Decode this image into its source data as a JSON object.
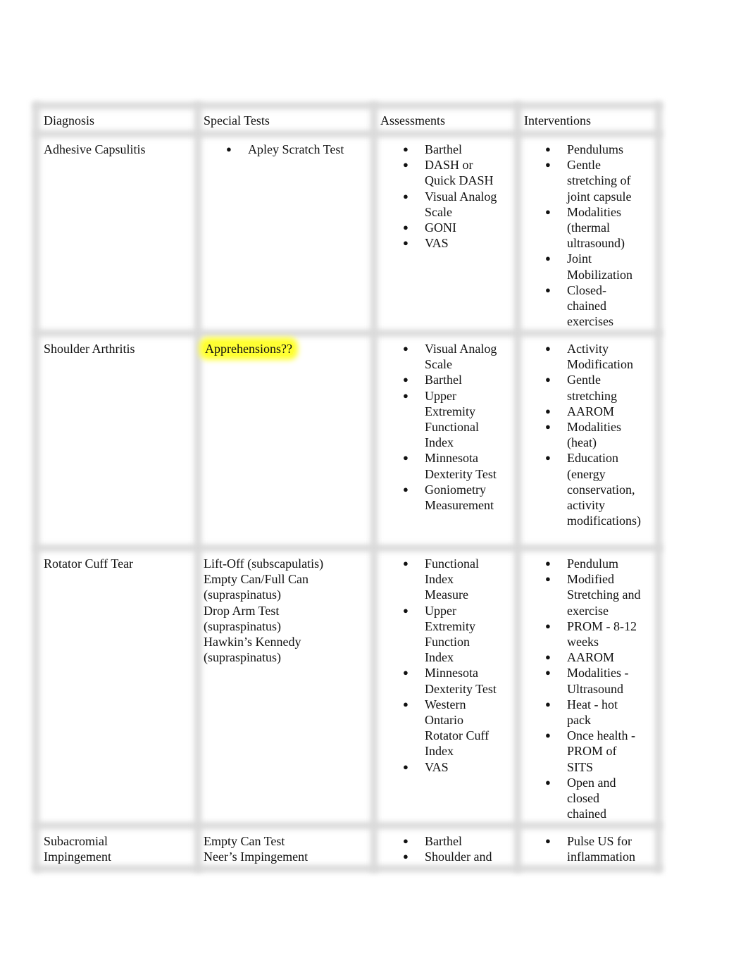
{
  "document": {
    "table": {
      "headers": [
        "Diagnosis",
        "Special Tests",
        "Assessments",
        "Interventions"
      ],
      "rows": [
        {
          "diagnosis": "Adhesive Capsulitis",
          "special_tests": {
            "type": "bullets",
            "items": [
              "Apley Scratch Test"
            ]
          },
          "assessments": [
            "Barthel",
            "DASH or Quick DASH",
            "Visual Analog Scale",
            "GONI",
            "VAS"
          ],
          "interventions": [
            "Pendulums",
            "Gentle stretching of joint capsule",
            "Modalities (thermal ultrasound)",
            "Joint Mobilization",
            "Closed-chained exercises"
          ]
        },
        {
          "diagnosis": "Shoulder Arthritis",
          "special_tests": {
            "type": "highlight",
            "text": "Apprehensions??",
            "highlight_color": "#ffff33"
          },
          "assessments": [
            "Visual Analog Scale",
            "Barthel",
            "Upper Extremity Functional Index",
            "Minnesota Dexterity Test",
            "Goniometry Measurement"
          ],
          "interventions": [
            "Activity Modification",
            "Gentle stretching",
            "AAROM",
            "Modalities (heat)",
            "Education (energy conservation, activity modifications)"
          ]
        },
        {
          "diagnosis": "Rotator Cuff Tear",
          "special_tests": {
            "type": "lines",
            "items": [
              "Lift-Off (subscapulatis)",
              "Empty Can/Full Can (supraspinatus)",
              "Drop Arm Test (supraspinatus)",
              "Hawkin’s Kennedy (supraspinatus)"
            ]
          },
          "assessments": [
            "Functional Index Measure",
            "Upper Extremity Function Index",
            "Minnesota Dexterity Test",
            "Western Ontario Rotator Cuff Index",
            "VAS"
          ],
          "interventions": [
            "Pendulum",
            "Modified Stretching and exercise",
            "PROM - 8-12 weeks",
            "AAROM",
            "Modalities - Ultrasound",
            "Heat - hot pack",
            "Once health - PROM of SITS",
            "Open and closed chained"
          ]
        },
        {
          "diagnosis": "Subacromial Impingement",
          "special_tests": {
            "type": "lines",
            "items": [
              "Empty Can Test",
              "Neer’s Impingement"
            ]
          },
          "assessments": [
            "Barthel",
            "Shoulder and"
          ],
          "interventions": [
            "Pulse US for inflammation"
          ]
        }
      ]
    }
  }
}
